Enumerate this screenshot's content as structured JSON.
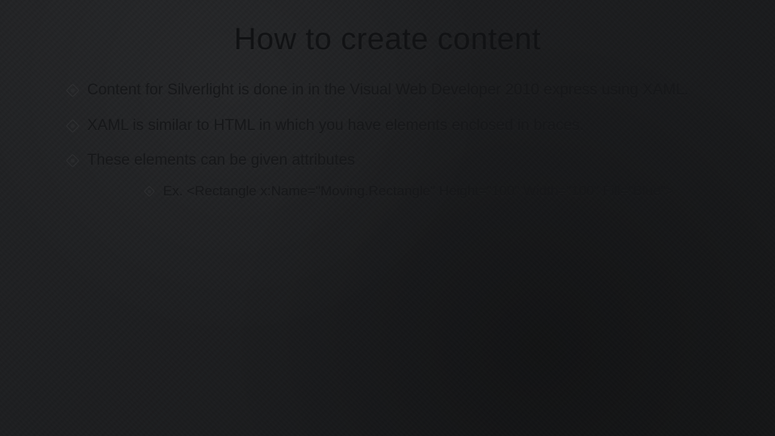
{
  "title": "How to create content",
  "bullets": [
    {
      "text": "Content for Silverlight is done in in the Visual Web Developer 2010 express using XAML."
    },
    {
      "text": "XAML is similar to HTML in which you have elements enclosed in braces."
    },
    {
      "text": "These elements can be given attributes",
      "sub": [
        {
          "text": "Ex. <Rectangle x:Name=\"Moving.Rectangle\" Height=\"100\" Width=\"100\" Fill=\"Blue\">"
        }
      ]
    }
  ]
}
